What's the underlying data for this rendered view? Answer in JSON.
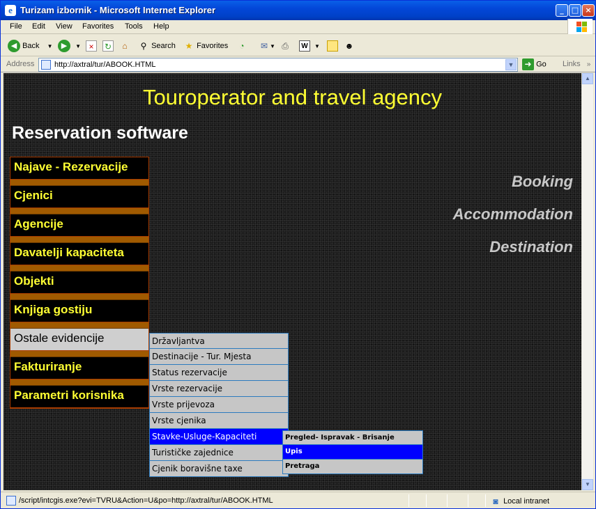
{
  "window": {
    "title": "Turizam izbornik - Microsoft Internet Explorer",
    "controls": {
      "minimize": "_",
      "maximize": "□",
      "close": "×"
    }
  },
  "menubar": [
    "File",
    "Edit",
    "View",
    "Favorites",
    "Tools",
    "Help"
  ],
  "toolbar": {
    "back": "Back",
    "search": "Search",
    "favorites": "Favorites"
  },
  "address": {
    "label": "Address",
    "url": "http://axtral/tur/ABOOK.HTML",
    "go": "Go",
    "links": "Links"
  },
  "page": {
    "heading": "Touroperator and travel agency",
    "subheading": "Reservation software",
    "right_labels": [
      "Booking",
      "Accommodation",
      "Destination"
    ],
    "menu": [
      {
        "label": "Najave - Rezervacije",
        "selected": false
      },
      {
        "label": "Cjenici",
        "selected": false
      },
      {
        "label": "Agencije",
        "selected": false
      },
      {
        "label": "Davatelji kapaciteta",
        "selected": false
      },
      {
        "label": "Objekti",
        "selected": false
      },
      {
        "label": "Knjiga gostiju",
        "selected": false
      },
      {
        "label": "Ostale evidencije",
        "selected": true
      },
      {
        "label": "Fakturiranje",
        "selected": false
      },
      {
        "label": "Parametri korisnika",
        "selected": false
      }
    ],
    "submenu": [
      {
        "label": "Državljantva",
        "selected": false
      },
      {
        "label": "Destinacije - Tur. Mjesta",
        "selected": false
      },
      {
        "label": "Status rezervacije",
        "selected": false
      },
      {
        "label": "Vrste rezervacije",
        "selected": false
      },
      {
        "label": "Vrste prijevoza",
        "selected": false
      },
      {
        "label": "Vrste cjenika",
        "selected": false
      },
      {
        "label": "Stavke-Usluge-Kapaciteti",
        "selected": true
      },
      {
        "label": "Turističke zajednice",
        "selected": false
      },
      {
        "label": "Cjenik boravišne taxe",
        "selected": false
      }
    ],
    "submenu2": [
      {
        "label": "Pregled- Ispravak - Brisanje",
        "selected": false
      },
      {
        "label": "Upis",
        "selected": true
      },
      {
        "label": "Pretraga",
        "selected": false
      }
    ]
  },
  "status": {
    "text": "/script/intcgis.exe?evi=TVRU&Action=U&po=http://axtral/tur/ABOOK.HTML",
    "zone": "Local intranet"
  },
  "colors": {
    "heading": "#ffff33",
    "menu_text": "#ffff33",
    "menu_separator": "#a05a00",
    "selection": "#0000ff"
  }
}
